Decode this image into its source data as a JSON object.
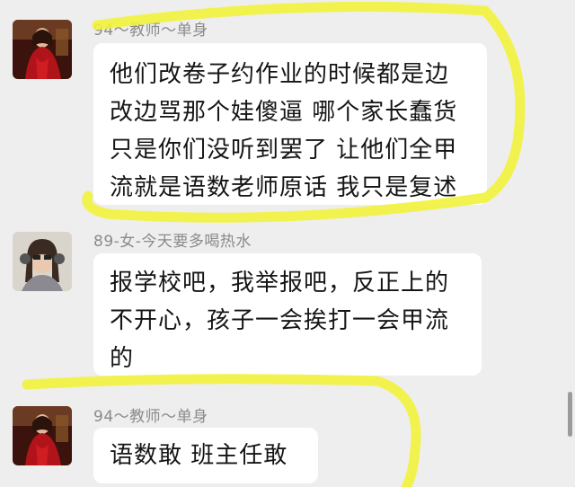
{
  "messages": [
    {
      "sender": "94～教师～单身",
      "lines": [
        "他们改卷子约作业的时候都是边",
        "改边骂那个娃傻逼 哪个家长蠢货",
        "只是你们没听到罢了 让他们全甲",
        "流就是语数老师原话 我只是复述"
      ]
    },
    {
      "sender": "89-女-今天要多喝热水",
      "lines": [
        "报学校吧，我举报吧，反正上的",
        "不开心，孩子一会挨打一会甲流",
        "的"
      ]
    },
    {
      "sender": "94～教师～单身",
      "lines": [
        "语数敢 班主任敢"
      ]
    }
  ],
  "colors": {
    "background": "#eeeeee",
    "bubble": "#ffffff",
    "highlight": "#f2f23c",
    "sender_text": "#8a8a8a"
  }
}
